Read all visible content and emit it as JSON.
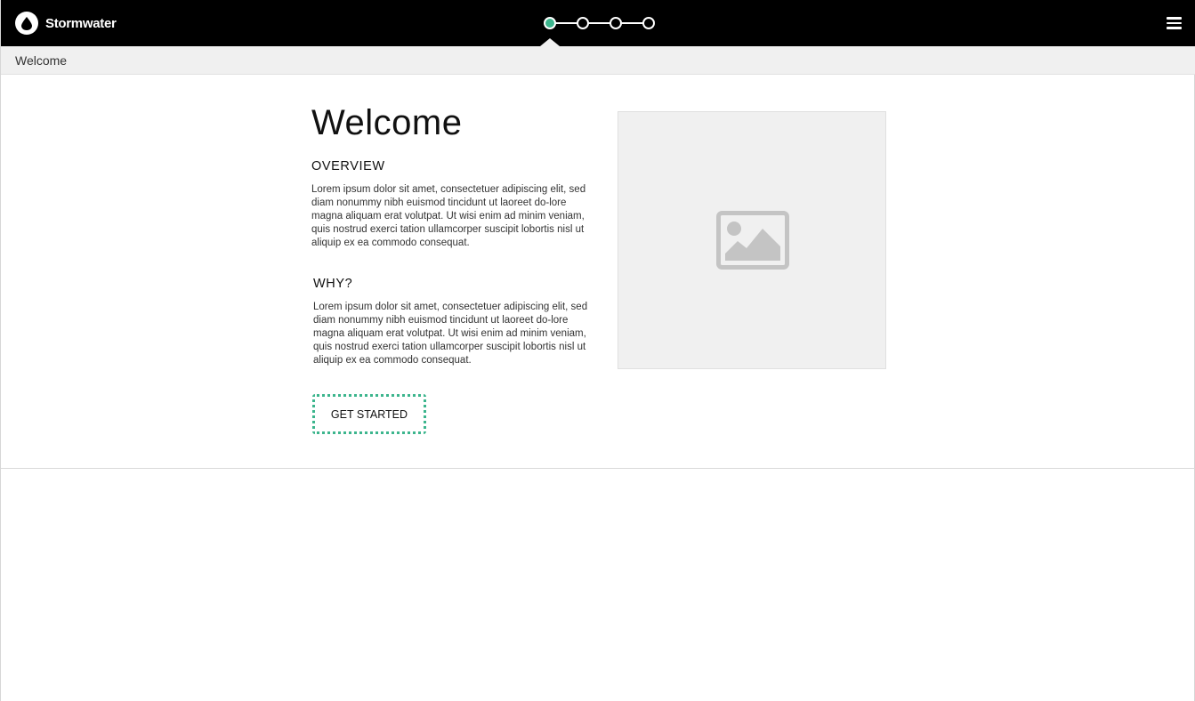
{
  "app": {
    "name": "Stormwater",
    "logo_icon": "water-drop-icon"
  },
  "stepper": {
    "total_steps": 4,
    "current_step": 1,
    "active_color": "#3cb58d"
  },
  "menu": {
    "icon": "hamburger-menu-icon"
  },
  "breadcrumb": {
    "current": "Welcome"
  },
  "main": {
    "title": "Welcome",
    "sections": [
      {
        "heading": "OVERVIEW",
        "body": "Lorem ipsum dolor sit amet, consectetuer adipiscing elit, sed diam nonummy nibh euismod tincidunt ut laoreet do-lore magna aliquam erat volutpat. Ut wisi enim ad minim veniam, quis nostrud exerci tation ullamcorper suscipit lobortis nisl ut aliquip ex ea commodo consequat."
      },
      {
        "heading": "WHY?",
        "body": "Lorem ipsum dolor sit amet, consectetuer adipiscing elit, sed diam nonummy nibh euismod tincidunt ut laoreet do-lore magna aliquam erat volutpat. Ut wisi enim ad minim veniam, quis nostrud exerci tation ullamcorper suscipit lobortis nisl ut aliquip ex ea commodo consequat."
      }
    ],
    "cta_label": "GET STARTED",
    "image_icon": "image-placeholder-icon"
  },
  "colors": {
    "header_bg": "#000000",
    "accent": "#3cb58d",
    "breadcrumb_bg": "#f0f0f0"
  }
}
